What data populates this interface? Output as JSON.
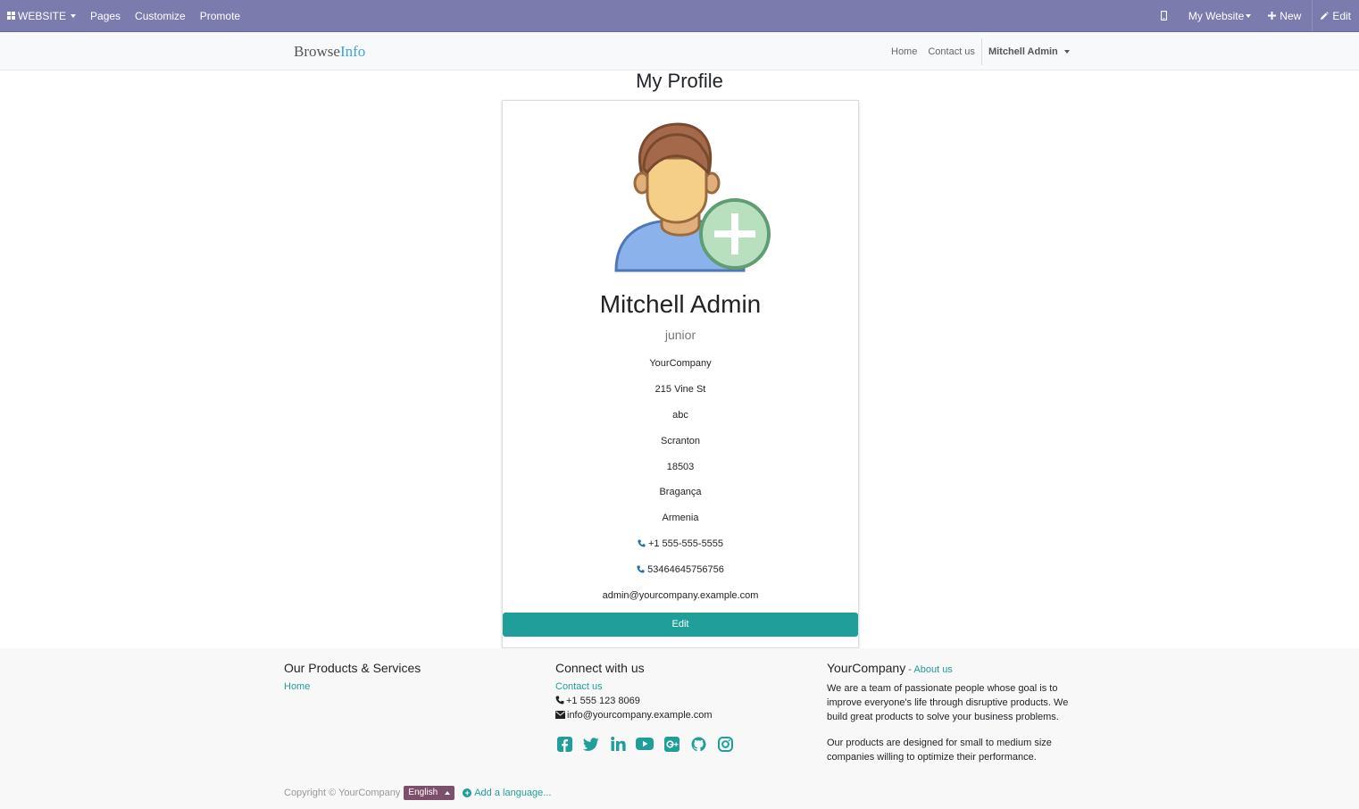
{
  "adminbar": {
    "website_label": "WEBSITE",
    "pages_label": "Pages",
    "customize_label": "Customize",
    "promote_label": "Promote",
    "my_website_label": "My Website",
    "new_label": "New",
    "edit_label": "Edit"
  },
  "navbar": {
    "brand_part1": "Browse",
    "brand_part2": "Info",
    "home_label": "Home",
    "contact_label": "Contact us",
    "user_label": "Mitchell Admin"
  },
  "profile": {
    "page_title": "My Profile",
    "name": "Mitchell Admin",
    "job": "junior",
    "company": "YourCompany",
    "street": "215 Vine St",
    "street2": "abc",
    "city": "Scranton",
    "zip": "18503",
    "state": "Bragança",
    "country": "Armenia",
    "phone": "+1 555-555-5555",
    "mobile": "53464645756756",
    "email": "admin@yourcompany.example.com",
    "edit_label": "Edit"
  },
  "footer": {
    "col1": {
      "title": "Our Products & Services",
      "home_link": "Home"
    },
    "col2": {
      "title": "Connect with us",
      "contact_link": "Contact us",
      "phone": "+1 555 123 8069",
      "email": "info@yourcompany.example.com"
    },
    "col3": {
      "title": "YourCompany",
      "dash": " - ",
      "about_link": "About us",
      "para1": "We are a team of passionate people whose goal is to improve everyone's life through disruptive products. We build great products to solve your business problems.",
      "para2": "Our products are designed for small to medium size companies willing to optimize their performance."
    },
    "copyright": "Copyright © YourCompany",
    "language": "English",
    "add_language": "Add a language..."
  },
  "colors": {
    "adminbar": "#7c7bad",
    "accent": "#1f9e9a",
    "brand_info": "#3aa6dd",
    "lang_badge": "#7c4f6b"
  },
  "social_icons": [
    "facebook-icon",
    "twitter-icon",
    "linkedin-icon",
    "youtube-icon",
    "google-plus-icon",
    "github-icon",
    "instagram-icon"
  ]
}
